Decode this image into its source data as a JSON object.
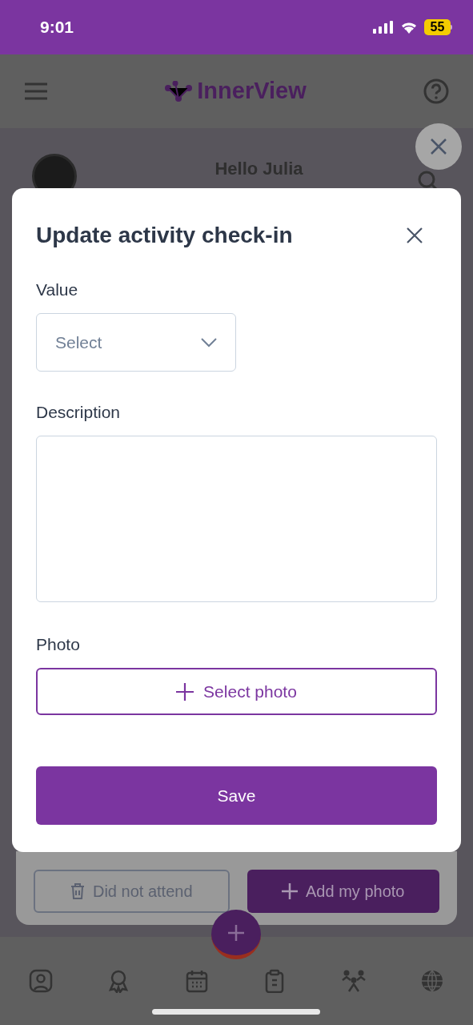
{
  "status_bar": {
    "time": "9:01",
    "battery": "55"
  },
  "header": {
    "logo": "InnerView"
  },
  "greeting": {
    "title": "Hello Julia"
  },
  "card_actions": [
    {
      "kind": "outline",
      "label": "Did not attend"
    },
    {
      "kind": "primary",
      "label": "Add my photo"
    }
  ],
  "modal": {
    "title": "Update activity check-in",
    "fields": [
      {
        "kind": "select",
        "label": "Value",
        "placeholder": "Select"
      },
      {
        "kind": "textarea",
        "label": "Description"
      },
      {
        "kind": "photo",
        "label": "Photo",
        "button": "Select photo"
      }
    ],
    "save": "Save"
  }
}
